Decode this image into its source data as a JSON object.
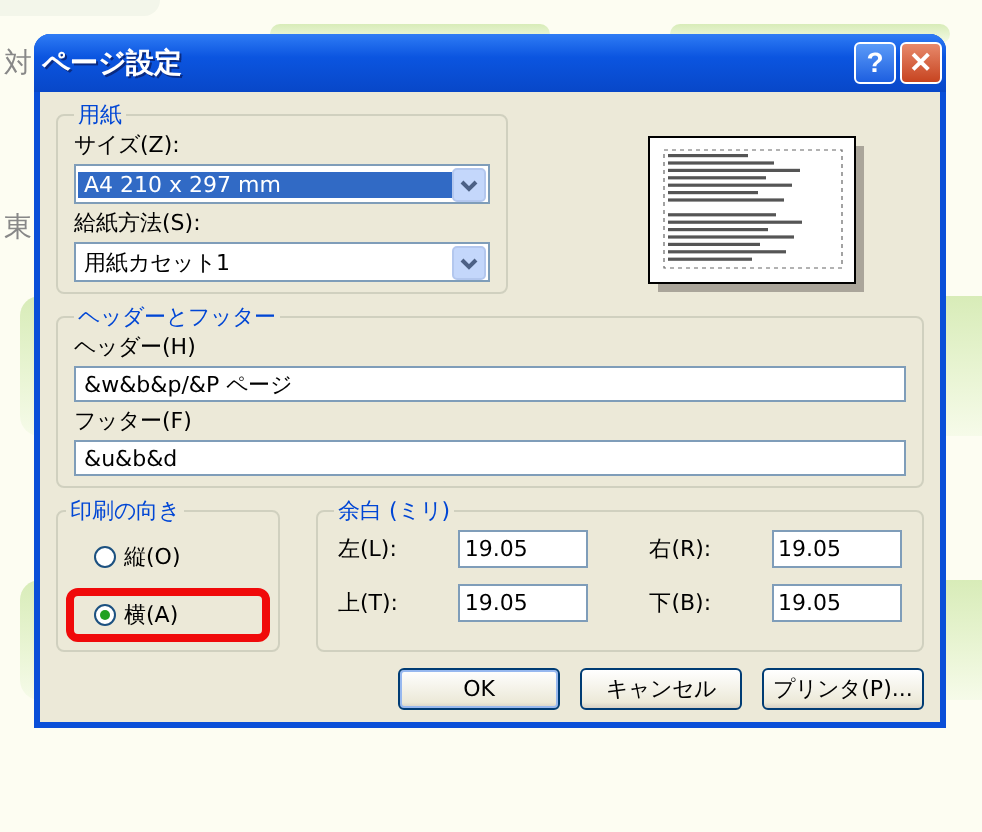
{
  "background": {
    "texts": [
      "対",
      "東"
    ]
  },
  "window": {
    "title": "ページ設定",
    "buttons": [
      {
        "kind": "help",
        "label": "?"
      },
      {
        "kind": "close",
        "label": "✕"
      }
    ]
  },
  "paper": {
    "title": "用紙",
    "size_label": "サイズ(Z):",
    "size_value": "A4 210 x 297 mm",
    "source_label": "給紙方法(S):",
    "source_value": "用紙カセット1"
  },
  "header_footer": {
    "title": "ヘッダーとフッター",
    "header_label": "ヘッダー(H)",
    "header_value": "&w&b&p/&P ページ",
    "footer_label": "フッター(F)",
    "footer_value": "&u&b&d"
  },
  "orientation": {
    "title": "印刷の向き",
    "options": [
      {
        "label": "縦(O)",
        "selected": false,
        "circled": false
      },
      {
        "label": "横(A)",
        "selected": true,
        "circled": true
      }
    ]
  },
  "margins": {
    "title": "余白 (ミリ)",
    "fields": [
      {
        "label": "左(L):",
        "value": "19.05"
      },
      {
        "label": "右(R):",
        "value": "19.05"
      },
      {
        "label": "上(T):",
        "value": "19.05"
      },
      {
        "label": "下(B):",
        "value": "19.05"
      }
    ]
  },
  "buttons": [
    {
      "label": "OK",
      "default": true
    },
    {
      "label": "キャンセル",
      "default": false
    },
    {
      "label": "プリンタ(P)...",
      "default": false
    }
  ]
}
